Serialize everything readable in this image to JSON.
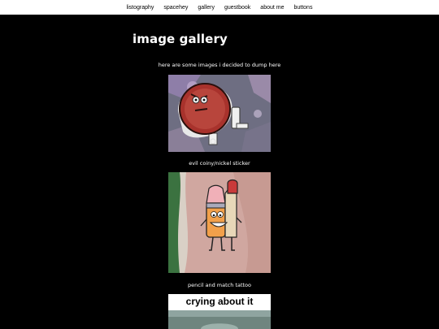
{
  "nav": {
    "items": [
      {
        "label": "listography"
      },
      {
        "label": "spacehey"
      },
      {
        "label": "gallery"
      },
      {
        "label": "guestbook"
      },
      {
        "label": "about me"
      },
      {
        "label": "buttons"
      }
    ]
  },
  "page": {
    "title": "image gallery",
    "intro": "here are some images i decided to dump here"
  },
  "gallery": {
    "items": [
      {
        "caption": "evil coiny/nickel sticker"
      },
      {
        "caption": "pencil and match tattoo"
      },
      {
        "image_text": "crying about it"
      }
    ]
  },
  "colors": {
    "background": "#000000",
    "nav_background": "#ffffff",
    "text": "#ffffff"
  }
}
